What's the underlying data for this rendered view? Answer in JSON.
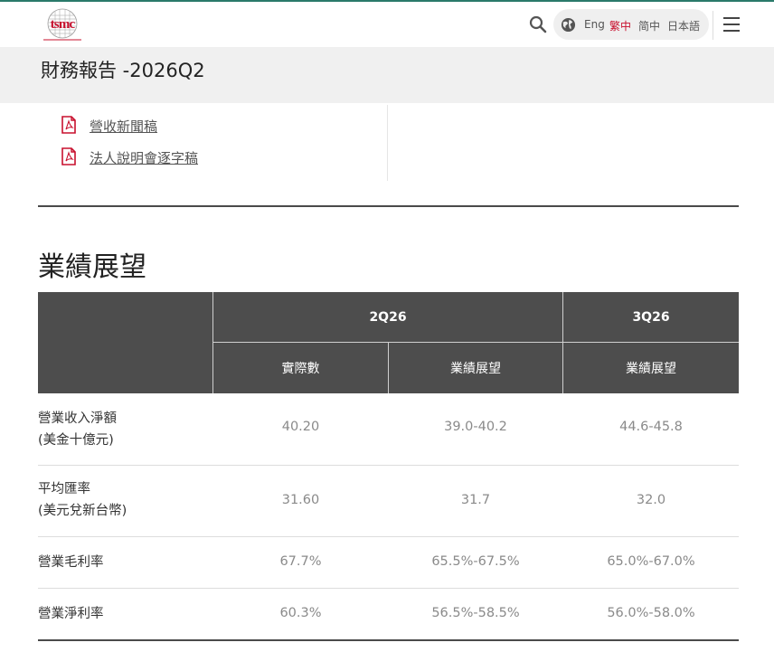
{
  "header": {
    "logo_text": "tsmc",
    "languages": [
      {
        "label": "Eng",
        "active": false
      },
      {
        "label": "繁中",
        "active": true
      },
      {
        "label": "简中",
        "active": false
      },
      {
        "label": "日本語",
        "active": false
      }
    ],
    "icons": {
      "search": "search-icon",
      "globe": "globe-icon",
      "menu": "hamburger-menu-icon"
    },
    "colors": {
      "accent": "#c8102e",
      "top_line": "#2a7a6a",
      "header_cell_bg": "#4d4d4d"
    }
  },
  "page": {
    "title": "財務報告 -2026Q2"
  },
  "links": [
    {
      "label": "營收新聞稿",
      "icon": "pdf-icon"
    },
    {
      "label": "法人說明會逐字稿",
      "icon": "pdf-icon"
    }
  ],
  "outlook": {
    "title": "業績展望",
    "table": {
      "groups": [
        "2Q26",
        "3Q26"
      ],
      "subheaders": [
        "實際數",
        "業績展望",
        "業績展望"
      ],
      "rows": [
        {
          "label_line1": "營業收入淨額",
          "label_line2": "(美金十億元)",
          "values": [
            "40.20",
            "39.0-40.2",
            "44.6-45.8"
          ]
        },
        {
          "label_line1": "平均匯率",
          "label_line2": "(美元兌新台幣)",
          "values": [
            "31.60",
            "31.7",
            "32.0"
          ]
        },
        {
          "label_line1": "營業毛利率",
          "label_line2": "",
          "values": [
            "67.7%",
            "65.5%-67.5%",
            "65.0%-67.0%"
          ]
        },
        {
          "label_line1": "營業淨利率",
          "label_line2": "",
          "values": [
            "60.3%",
            "56.5%-58.5%",
            "56.0%-58.0%"
          ]
        }
      ]
    }
  }
}
